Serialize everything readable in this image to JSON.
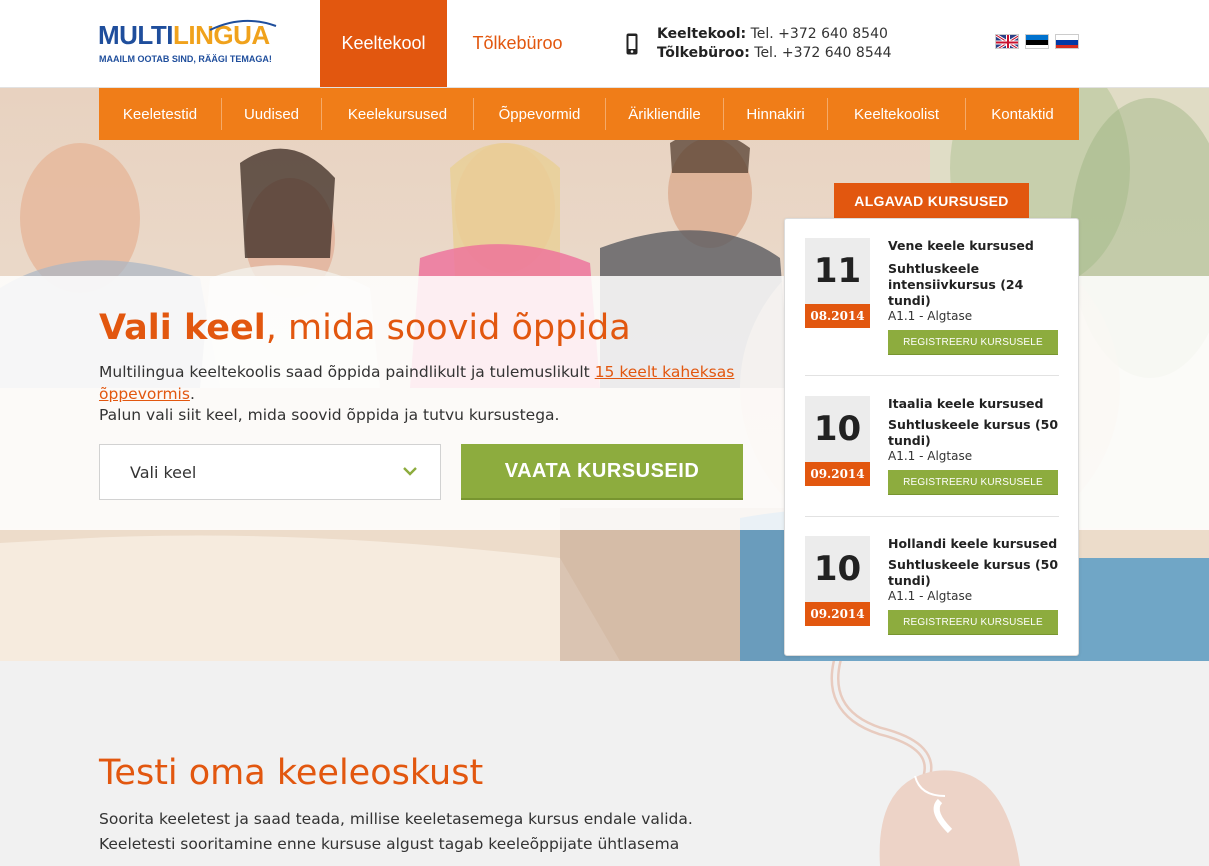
{
  "header": {
    "logo_main_a": "MULTI",
    "logo_main_b": "LINGUA",
    "logo_tagline": "MAAILM OOTAB SIND, RÄÄGI TEMAGA!",
    "site_tabs": [
      "Keeltekool",
      "Tõlkebüroo"
    ],
    "contacts": [
      {
        "label": "Keeltekool:",
        "value": "Tel. +372 640 8540"
      },
      {
        "label": "Tõlkebüroo:",
        "value": "Tel. +372 640 8544"
      }
    ],
    "languages": [
      "english-flag-icon",
      "estonian-flag-icon",
      "russian-flag-icon"
    ]
  },
  "nav": {
    "items": [
      "Keeletestid",
      "Uudised",
      "Keelekursused",
      "Õppevormid",
      "Ärikliendile",
      "Hinnakiri",
      "Keeltekoolist",
      "Kontaktid"
    ]
  },
  "hero": {
    "headline_bold": "Vali keel",
    "headline_rest": ", mida soovid õppida",
    "intro_pre": "Multilingua keeltekoolis saad õppida paindlikult ja tulemuslikult ",
    "intro_link": "15 keelt kaheksas õppevormis",
    "intro_post": ".",
    "intro_line2": "Palun vali siit keel, mida soovid õppida ja tutvu kursustega.",
    "select_label": "Vali keel",
    "cta_label": "VAATA KURSUSEID"
  },
  "courses": {
    "header": "ALGAVAD KURSUSED",
    "items": [
      {
        "day": "11",
        "month": "08.2014",
        "title": "Vene keele kursused",
        "desc": "Suhtluskeele intensiivkursus (24 tundi)",
        "level": "A1.1 - Algtase",
        "button": "REGISTREERU KURSUSELE"
      },
      {
        "day": "10",
        "month": "09.2014",
        "title": "Itaalia keele kursused",
        "desc": "Suhtluskeele kursus (50 tundi)",
        "level": "A1.1 - Algtase",
        "button": "REGISTREERU KURSUSELE"
      },
      {
        "day": "10",
        "month": "09.2014",
        "title": "Hollandi keele kursused",
        "desc": "Suhtluskeele kursus (50 tundi)",
        "level": "A1.1 - Algtase",
        "button": "REGISTREERU KURSUSELE"
      }
    ]
  },
  "test": {
    "title": "Testi oma keeleoskust",
    "body_line1": "Soorita keeletest ja saad teada, millise keeletasemega kursus endale valida.",
    "body_line2": "Keeletesti sooritamine enne kursuse algust tagab keeleõppijate ühtlasema"
  },
  "colors": {
    "brand_orange": "#e2570f",
    "nav_orange": "#f07d18",
    "cta_green": "#8dac3e",
    "logo_blue": "#1f4e9c",
    "logo_gold": "#f0a21c"
  }
}
